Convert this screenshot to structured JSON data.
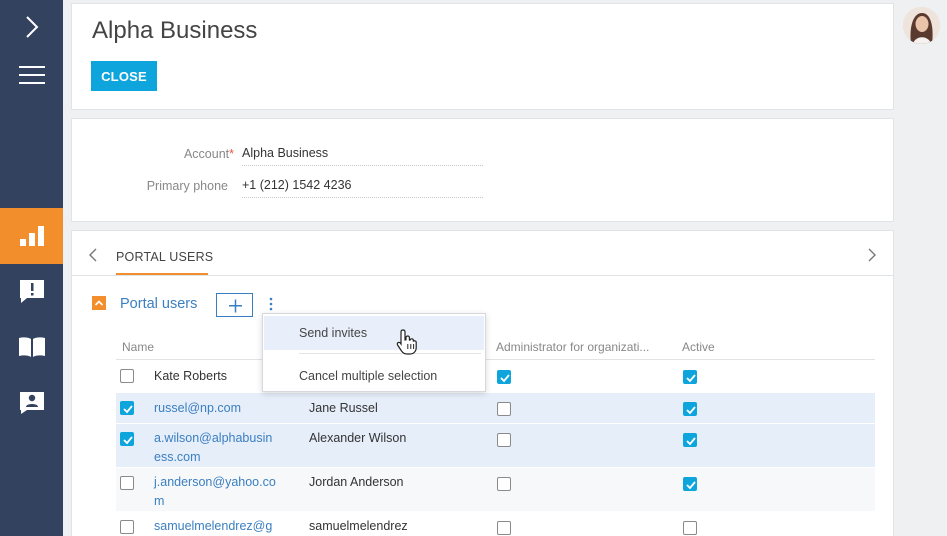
{
  "header": {
    "title": "Alpha Business",
    "close_label": "CLOSE"
  },
  "fields": {
    "account_label": "Account",
    "account_required_mark": "*",
    "account_value": "Alpha Business",
    "phone_label": "Primary phone",
    "phone_value": "+1 (212) 1542 4236"
  },
  "tabs": {
    "active_label": "PORTAL USERS"
  },
  "detail": {
    "title": "Portal users"
  },
  "grid": {
    "columns": [
      "Name",
      "Administrator for organizati...",
      "Active"
    ],
    "rows": [
      {
        "login": "Kate Roberts",
        "contact": "",
        "admin": true,
        "active": true,
        "selected": false
      },
      {
        "login": "russel@np.com",
        "contact": "Jane Russel",
        "admin": false,
        "active": true,
        "selected": true
      },
      {
        "login": "a.wilson@alphabusin ess.com",
        "login_line1": "a.wilson@alphabusin",
        "login_line2": "ess.com",
        "contact": "Alexander Wilson",
        "admin": false,
        "active": true,
        "selected": true
      },
      {
        "login": "j.anderson@yahoo.co m",
        "login_line1": "j.anderson@yahoo.co",
        "login_line2": "m",
        "contact": "Jordan Anderson",
        "admin": false,
        "active": true,
        "selected": false
      },
      {
        "login": "samuelmelendrez@g",
        "contact": "samuelmelendrez",
        "admin": false,
        "active": false,
        "selected": false
      }
    ]
  },
  "menu": {
    "items": [
      "Send invites",
      "Cancel multiple selection"
    ]
  },
  "colors": {
    "nav_bg": "#33425e",
    "accent_orange": "#f28e2b",
    "primary_blue": "#0ea5dc",
    "link_blue": "#3a7fc1",
    "selected_row": "#e6eefa"
  },
  "icons": [
    "chevron-right-icon",
    "hamburger-menu-icon",
    "analytics-icon",
    "feed-icon",
    "knowledge-base-icon",
    "contact-card-icon",
    "avatar",
    "chevron-left-icon",
    "plus-icon",
    "kebab-icon",
    "checkbox-icon",
    "hand-cursor-icon"
  ]
}
